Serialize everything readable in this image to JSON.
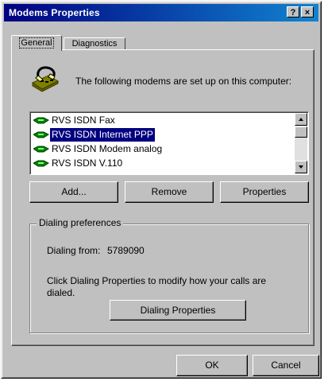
{
  "window": {
    "title": "Modems Properties",
    "help_button": "?",
    "close_button": "×"
  },
  "tabs": [
    {
      "label": "General",
      "active": true
    },
    {
      "label": "Diagnostics",
      "active": false
    }
  ],
  "intro_text": "The following modems are set up on this computer:",
  "modems": [
    {
      "label": "RVS ISDN Fax",
      "selected": false
    },
    {
      "label": "RVS ISDN Internet PPP",
      "selected": true
    },
    {
      "label": "RVS ISDN Modem analog",
      "selected": false
    },
    {
      "label": "RVS ISDN V.110",
      "selected": false
    }
  ],
  "buttons": {
    "add": "Add...",
    "remove": "Remove",
    "properties": "Properties",
    "dialing_properties": "Dialing Properties",
    "ok": "OK",
    "cancel": "Cancel"
  },
  "dialing_preferences": {
    "group_title": "Dialing preferences",
    "dialing_from_label": "Dialing from:",
    "dialing_from_value": "5789090",
    "instructions_line1": "Click Dialing Properties to modify how your calls are",
    "instructions_line2": "dialed."
  },
  "colors": {
    "title_bar": "#000080",
    "selection": "#000080",
    "face": "#c0c0c0"
  }
}
